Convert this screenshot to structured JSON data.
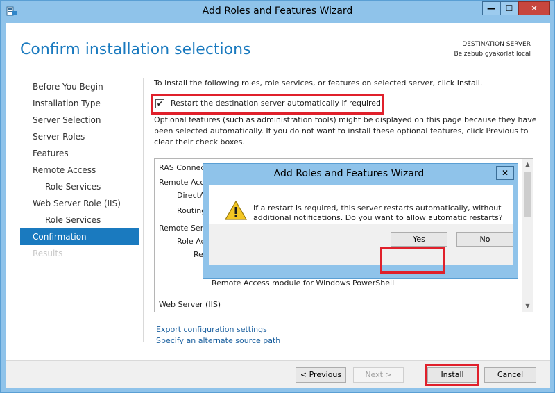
{
  "window": {
    "title": "Add Roles and Features Wizard",
    "controls": {
      "minimize": "—",
      "maximize": "☐",
      "close": "✕"
    }
  },
  "header": {
    "page_title": "Confirm installation selections",
    "destination_label": "DESTINATION SERVER",
    "destination_server": "Belzebub.gyakorlat.local"
  },
  "nav": {
    "items": [
      {
        "label": "Before You Begin",
        "state": "normal"
      },
      {
        "label": "Installation Type",
        "state": "normal"
      },
      {
        "label": "Server Selection",
        "state": "normal"
      },
      {
        "label": "Server Roles",
        "state": "normal"
      },
      {
        "label": "Features",
        "state": "normal"
      },
      {
        "label": "Remote Access",
        "state": "normal"
      },
      {
        "label": "Role Services",
        "state": "sub"
      },
      {
        "label": "Web Server Role (IIS)",
        "state": "normal"
      },
      {
        "label": "Role Services",
        "state": "sub"
      },
      {
        "label": "Confirmation",
        "state": "active"
      },
      {
        "label": "Results",
        "state": "disabled"
      }
    ]
  },
  "content": {
    "intro": "To install the following roles, role services, or features on selected server, click Install.",
    "restart_checkbox": {
      "checked": true,
      "mark": "✔",
      "label": "Restart the destination server automatically if required"
    },
    "optional_text": "Optional features (such as administration tools) might be displayed on this page because they have been selected automatically. If you do not want to install these optional features, click Previous to clear their check boxes.",
    "list_items": [
      "RAS Connec",
      "Remote Acc",
      "DirectA",
      "Routing",
      "Remote Ser",
      "Role Ad",
      "Re",
      "Remote Access module for Windows PowerShell",
      "Web Server (IIS)"
    ],
    "links": {
      "export": "Export configuration settings",
      "alternate_source": "Specify an alternate source path"
    }
  },
  "footer": {
    "previous": "< Previous",
    "next": "Next >",
    "install": "Install",
    "cancel": "Cancel"
  },
  "dialog": {
    "title": "Add Roles and Features Wizard",
    "close": "✕",
    "icon": "warning-icon",
    "message": "If a restart is required, this server restarts automatically, without additional notifications. Do you want to allow automatic restarts?",
    "yes": "Yes",
    "no": "No"
  },
  "colors": {
    "accent": "#1a7abf",
    "highlight": "#e0202b",
    "window_frame": "#8fc3ea"
  }
}
